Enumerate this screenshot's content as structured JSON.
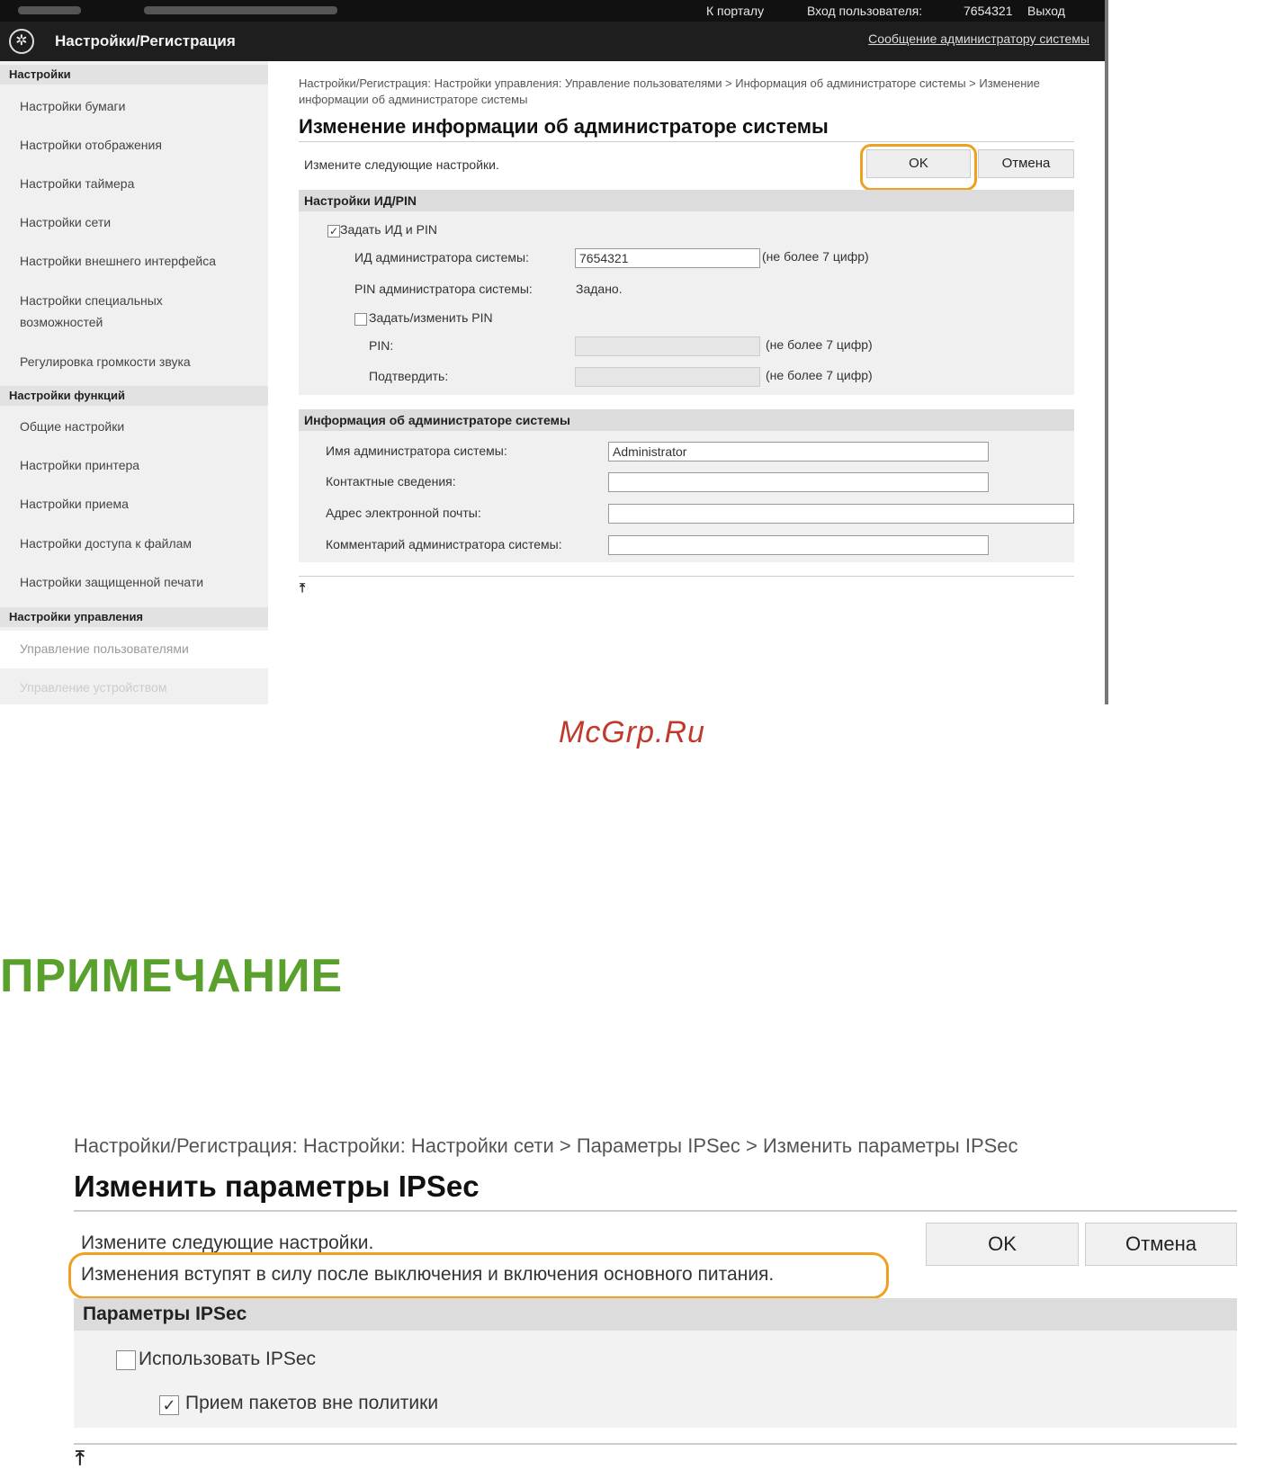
{
  "screen1": {
    "topbar": {
      "portal_link": "К порталу",
      "login_label": "Вход пользователя:",
      "login_user": "7654321",
      "logout": "Выход"
    },
    "app_title": "Настройки/Регистрация",
    "admin_message_link": "Сообщение администратору системы",
    "sidebar": {
      "section_settings": "Настройки",
      "items_settings": [
        "Настройки бумаги",
        "Настройки отображения",
        "Настройки таймера",
        "Настройки сети",
        "Настройки внешнего интерфейса",
        "Настройки специальных возможностей",
        "Регулировка громкости звука"
      ],
      "section_functions": "Настройки функций",
      "items_functions": [
        "Общие настройки",
        "Настройки принтера",
        "Настройки приема",
        "Настройки доступа к файлам",
        "Настройки защищенной печати"
      ],
      "section_management": "Настройки управления",
      "items_management": [
        "Управление пользователями",
        "Управление устройством"
      ]
    },
    "breadcrumb": "Настройки/Регистрация: Настройки управления: Управление пользователями > Информация об администраторе системы > Изменение информации об администраторе системы",
    "page_title": "Изменение информации об администраторе системы",
    "instruction": "Измените следующие настройки.",
    "ok_label": "OK",
    "cancel_label": "Отмена",
    "id_pin_panel": {
      "title": "Настройки ИД/PIN",
      "set_id_pin_label": "Задать ИД и PIN",
      "set_id_pin_checked": true,
      "admin_id_label": "ИД администратора системы:",
      "admin_id_value": "7654321",
      "admin_id_hint": "(не более 7 цифр)",
      "admin_pin_label": "PIN администратора системы:",
      "admin_pin_value": "Задано.",
      "set_change_pin_label": "Задать/изменить PIN",
      "set_change_pin_checked": false,
      "pin_label": "PIN:",
      "pin_hint": "(не более 7 цифр)",
      "confirm_label": "Подтвердить:",
      "confirm_hint": "(не более 7 цифр)"
    },
    "admin_info_panel": {
      "title": "Информация об администраторе системы",
      "name_label": "Имя администратора системы:",
      "name_value": "Administrator",
      "contact_label": "Контактные сведения:",
      "contact_value": "",
      "email_label": "Адрес электронной почты:",
      "email_value": "",
      "comment_label": "Комментарий администратора системы:",
      "comment_value": ""
    },
    "to_top_icon": "to-top-icon"
  },
  "watermark": "McGrp.Ru",
  "note_heading": "ПРИМЕЧАНИЕ",
  "screen2": {
    "breadcrumb": "Настройки/Регистрация: Настройки: Настройки сети > Параметры IPSec > Изменить параметры IPSec",
    "page_title": "Изменить параметры IPSec",
    "instruction": "Измените следующие настройки.",
    "note": "Изменения вступят в силу после выключения и включения основного питания.",
    "ok_label": "OK",
    "cancel_label": "Отмена",
    "panel_title": "Параметры IPSec",
    "use_ipsec_label": "Использовать IPSec",
    "use_ipsec_checked": false,
    "receive_non_policy_label": "Прием пакетов вне политики",
    "receive_non_policy_checked": true
  },
  "colors": {
    "highlight": "#f0a020",
    "note_heading": "#5aa02c",
    "watermark": "#c0392b"
  }
}
